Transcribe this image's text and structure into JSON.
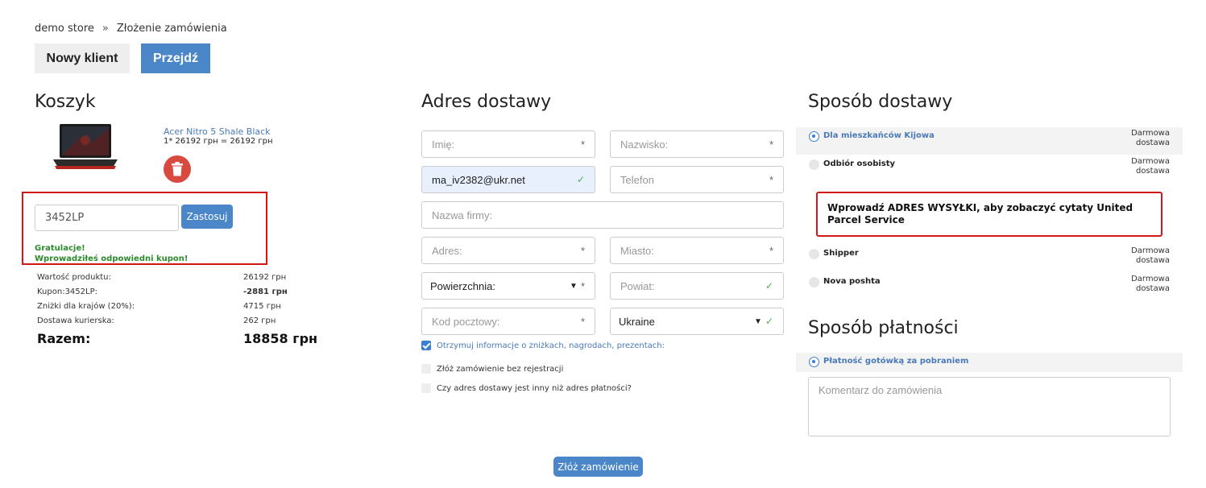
{
  "breadcrumb": {
    "store": "demo store",
    "separator": "»",
    "current": "Złożenie zamówienia"
  },
  "top_buttons": {
    "new_client": "Nowy klient",
    "go": "Przejdź"
  },
  "cart": {
    "title": "Koszyk",
    "product": {
      "name": "Acer Nitro 5 Shale Black",
      "price_line": "1* 26192 грн = 26192 грн"
    },
    "coupon": {
      "value": "3452LP",
      "apply": "Zastosuj",
      "msg1": "Gratulacje!",
      "msg2": "Wprowadziłeś odpowiedni kupon!"
    },
    "summary": [
      {
        "label": "Wartość produktu:",
        "value": "26192 грн",
        "bold": false
      },
      {
        "label": "Kupon:3452LP:",
        "value": "-2881 грн",
        "bold": true
      },
      {
        "label": "Zniżki dla krajów (20%):",
        "value": "4715 грн",
        "bold": false
      },
      {
        "label": "Dostawa kurierska:",
        "value": "262 грн",
        "bold": false
      }
    ],
    "total_label": "Razem:",
    "total_value": "18858 грн"
  },
  "address": {
    "title": "Adres dostawy",
    "first_name": "Imię:",
    "last_name": "Nazwisko:",
    "email": "ma_iv2382@ukr.net",
    "phone": "Telefon",
    "company": "Nazwa firmy:",
    "street": "Adres:",
    "city": "Miasto:",
    "region": "Powierzchnia:",
    "district": "Powiat:",
    "postcode": "Kod pocztowy:",
    "country": "Ukraine",
    "newsletter": "Otrzymuj informacje o zniżkach, nagrodach, prezentach:",
    "no_register": "Złóż zamówienie bez rejestracji",
    "diff_address": "Czy adres dostawy jest inny niż adres płatności?"
  },
  "shipping": {
    "title": "Sposób dostawy",
    "methods": [
      {
        "name": "Dla mieszkańców Kijowa",
        "cost1": "Darmowa",
        "cost2": "dostawa"
      },
      {
        "name": "Odbiór osobisty",
        "cost1": "Darmowa",
        "cost2": "dostawa"
      },
      {
        "name": "Shipper",
        "cost1": "Darmowa",
        "cost2": "dostawa"
      },
      {
        "name": "Nova poshta",
        "cost1": "Darmowa",
        "cost2": "dostawa"
      }
    ],
    "ups_notice": "Wprowadź ADRES WYSYŁKI, aby zobaczyć cytaty United Parcel Service"
  },
  "payment": {
    "title": "Sposób płatności",
    "method": "Płatność gotówką za pobraniem",
    "comment_placeholder": "Komentarz do zamówienia"
  },
  "submit": "Złóż zamówienie",
  "colors": {
    "accent": "#4a86c8",
    "highlight_border": "#d01818",
    "success": "#2b8a2b",
    "delete": "#d84a3f"
  }
}
